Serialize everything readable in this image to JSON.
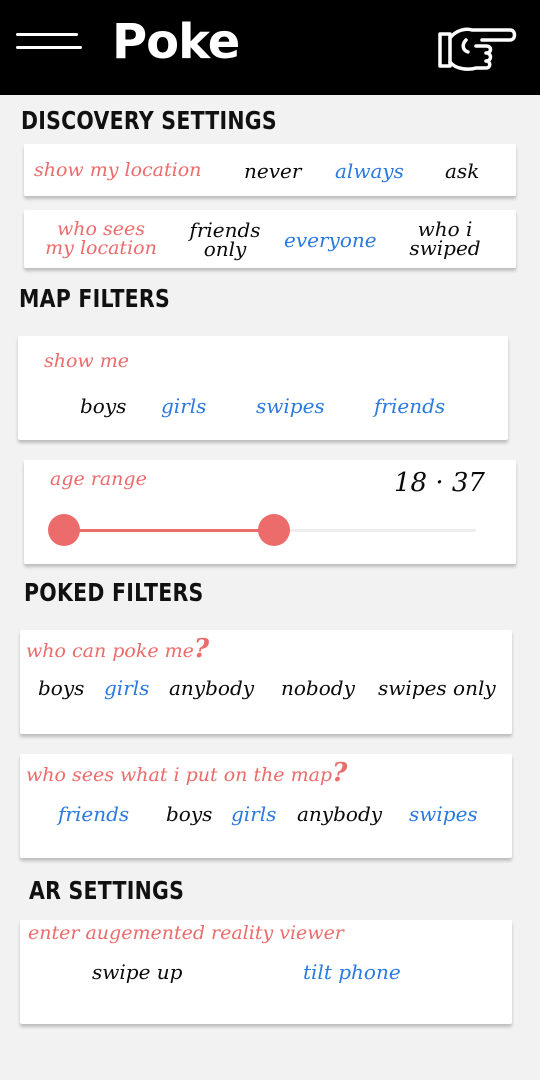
{
  "header": {
    "title": "Poke",
    "menu_icon": "hamburger-menu-icon",
    "poke_icon": "pointing-hand-icon"
  },
  "colors": {
    "accent": "#ec6b6b",
    "selected": "#2a7ae0",
    "text": "#0a0a0a",
    "header_bg": "#000000"
  },
  "discovery": {
    "title": "DISCOVERY SETTINGS",
    "show_location": {
      "label": "show my location",
      "options": [
        "never",
        "always",
        "ask"
      ],
      "selected": "always"
    },
    "who_sees": {
      "label_line1": "who sees",
      "label_line2": "my location",
      "options": [
        {
          "line1": "friends",
          "line2": "only"
        },
        {
          "line1": "everyone",
          "line2": ""
        },
        {
          "line1": "who i",
          "line2": "swiped"
        }
      ],
      "selected": "everyone"
    }
  },
  "map_filters": {
    "title": "MAP FILTERS",
    "show_me": {
      "label": "show me",
      "options": [
        "boys",
        "girls",
        "swipes",
        "friends"
      ],
      "selected": [
        "girls",
        "swipes",
        "friends"
      ]
    },
    "age_range": {
      "label": "age range",
      "min": 18,
      "max": 37,
      "display": "18 · 37"
    }
  },
  "poked_filters": {
    "title": "POKED FILTERS",
    "who_can_poke": {
      "label": "who can poke me",
      "q": "?",
      "options": [
        "boys",
        "girls",
        "anybody",
        "nobody",
        "swipes only"
      ],
      "selected": [
        "girls"
      ]
    },
    "who_sees_map": {
      "label": "who sees what i put on the map",
      "q": "?",
      "options": [
        "friends",
        "boys",
        "girls",
        "anybody",
        "swipes"
      ],
      "selected": [
        "friends",
        "girls",
        "swipes"
      ]
    }
  },
  "ar_settings": {
    "title": "AR SETTINGS",
    "enter": {
      "label": "enter augemented reality viewer",
      "options": [
        "swipe up",
        "tilt phone"
      ],
      "selected": [
        "tilt phone"
      ]
    }
  }
}
